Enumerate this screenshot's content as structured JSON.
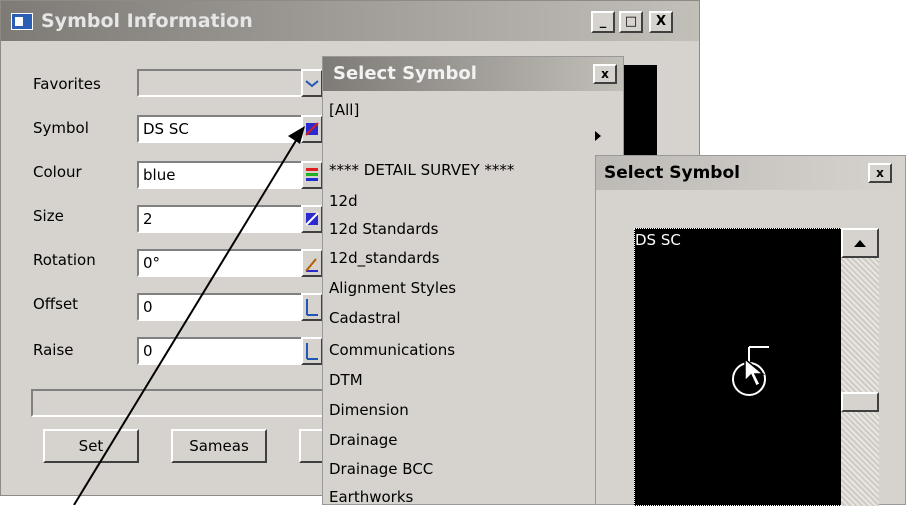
{
  "main_dialog": {
    "title": "Symbol Information",
    "minimize": "_",
    "maximize": "□",
    "close": "X",
    "fields": [
      {
        "label": "Favorites",
        "value": ""
      },
      {
        "label": "Symbol",
        "value": "DS SC"
      },
      {
        "label": "Colour",
        "value": "blue"
      },
      {
        "label": "Size",
        "value": "2"
      },
      {
        "label": "Rotation",
        "value": "0°"
      },
      {
        "label": "Offset",
        "value": "0"
      },
      {
        "label": "Raise",
        "value": "0"
      }
    ],
    "status_text": "",
    "buttons": {
      "set": "Set",
      "sameas": "Sameas"
    }
  },
  "symbol_list": {
    "title": "Select Symbol",
    "close": "x",
    "items": [
      "[All]",
      "",
      "**** DETAIL SURVEY ****",
      "12d",
      "12d Standards",
      "12d_standards",
      "Alignment Styles",
      "Cadastral",
      "Communications",
      "DTM",
      "Dimension",
      "Drainage",
      "Drainage BCC",
      "Earthworks"
    ]
  },
  "symbol_preview_window": {
    "title": "Select Symbol",
    "close": "x",
    "preview_name": "DS SC"
  },
  "colors": {
    "title_bar": "#7e7b77",
    "dialog_bg": "#d6d3ce",
    "colour_value": "blue"
  }
}
